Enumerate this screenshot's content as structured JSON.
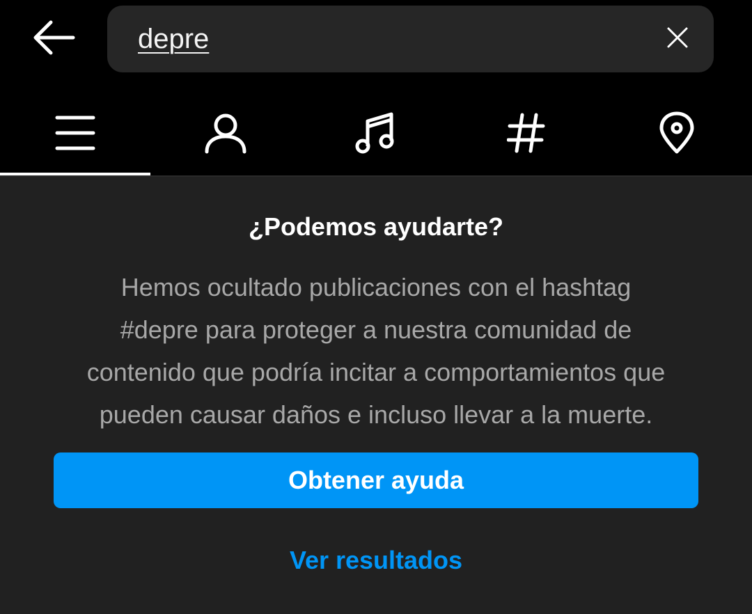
{
  "header": {
    "back_icon": "arrow-left-icon",
    "search": {
      "value": "depre",
      "clear_icon": "close-icon"
    }
  },
  "tabs": [
    {
      "icon": "menu-lines-icon",
      "active": true
    },
    {
      "icon": "person-icon",
      "active": false
    },
    {
      "icon": "music-note-icon",
      "active": false
    },
    {
      "icon": "hashtag-icon",
      "active": false
    },
    {
      "icon": "location-pin-icon",
      "active": false
    }
  ],
  "help": {
    "title": "¿Podemos ayudarte?",
    "body_lines": [
      "Hemos ocultado publicaciones con el hashtag",
      "#depre para proteger a nuestra comunidad de",
      "contenido que podría incitar a comportamientos que",
      "pueden causar daños e incluso llevar a la muerte."
    ],
    "primary_button": "Obtener ayuda",
    "secondary_link": "Ver resultados"
  },
  "colors": {
    "background": "#000000",
    "panel": "#212121",
    "search_field": "#262626",
    "accent_blue": "#0095f6",
    "body_text": "#a8a8a8",
    "primary_text": "#ffffff"
  }
}
